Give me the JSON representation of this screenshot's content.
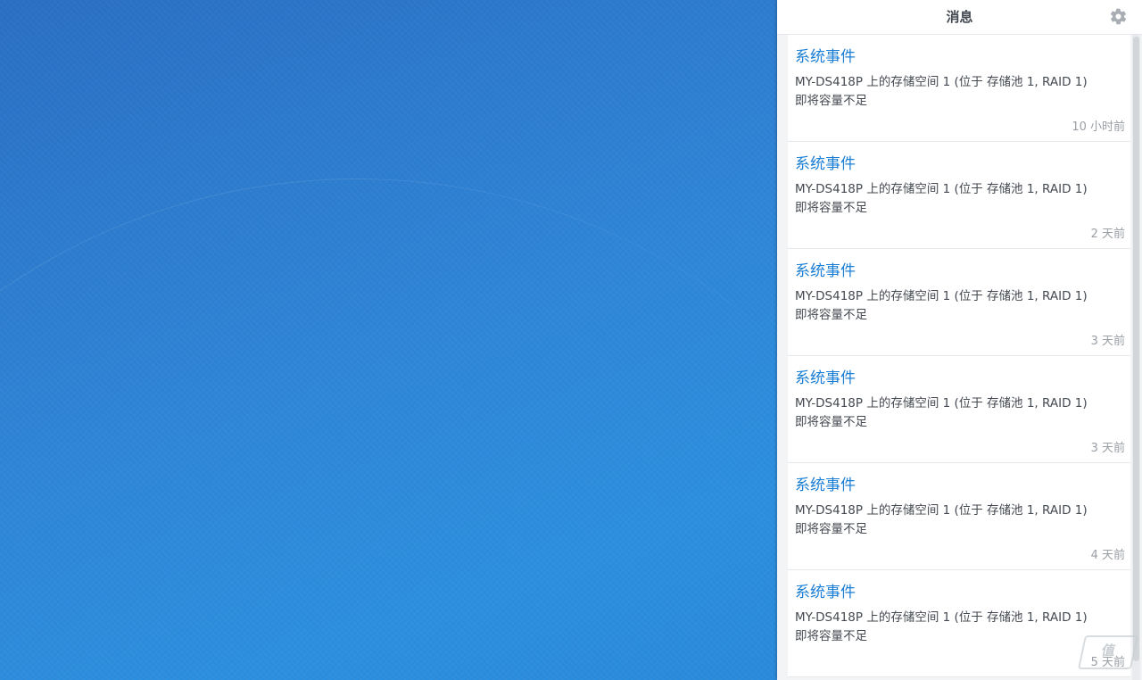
{
  "panel": {
    "title": "消息",
    "settings_icon": "gear-icon"
  },
  "notifications": [
    {
      "title": "系统事件",
      "line1": "MY-DS418P 上的存储空间 1 (位于 存储池 1, RAID 1)",
      "line2": "即将容量不足",
      "time": "10 小时前"
    },
    {
      "title": "系统事件",
      "line1": "MY-DS418P 上的存储空间 1 (位于 存储池 1, RAID 1)",
      "line2": "即将容量不足",
      "time": "2 天前"
    },
    {
      "title": "系统事件",
      "line1": "MY-DS418P 上的存储空间 1 (位于 存储池 1, RAID 1)",
      "line2": "即将容量不足",
      "time": "3 天前"
    },
    {
      "title": "系统事件",
      "line1": "MY-DS418P 上的存储空间 1 (位于 存储池 1, RAID 1)",
      "line2": "即将容量不足",
      "time": "3 天前"
    },
    {
      "title": "系统事件",
      "line1": "MY-DS418P 上的存储空间 1 (位于 存储池 1, RAID 1)",
      "line2": "即将容量不足",
      "time": "4 天前"
    },
    {
      "title": "系统事件",
      "line1": "MY-DS418P 上的存储空间 1 (位于 存储池 1, RAID 1)",
      "line2": "即将容量不足",
      "time": "5 天前"
    }
  ],
  "watermark": "值",
  "colors": {
    "accent": "#1b7ed6",
    "desktop": "#2f86d8",
    "body_text": "#444a52",
    "time_text": "#9aa0a6"
  }
}
